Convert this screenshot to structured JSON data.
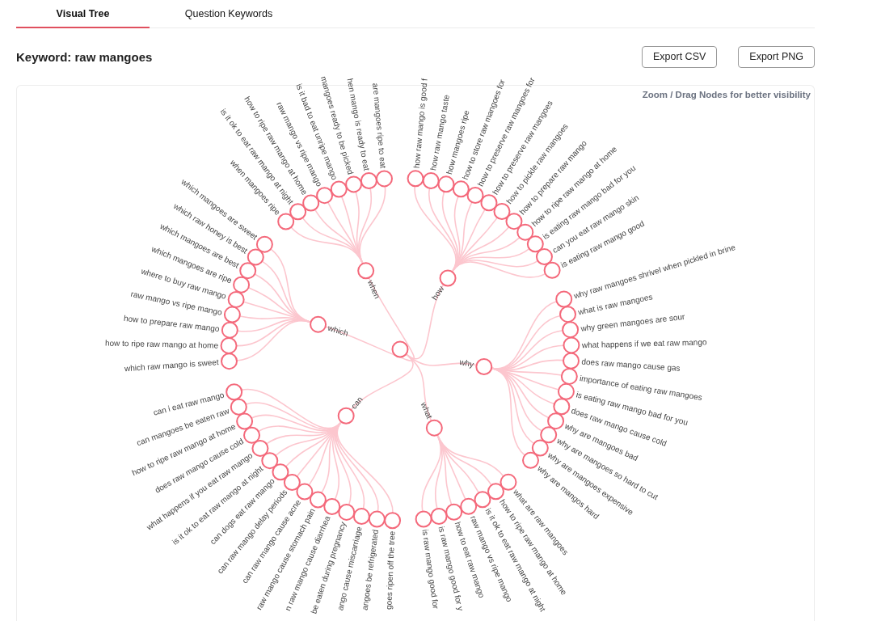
{
  "tabs": [
    {
      "label": "Visual Tree",
      "selected": true
    },
    {
      "label": "Question Keywords",
      "selected": false
    }
  ],
  "title": "Keyword: raw mangoes",
  "buttons": [
    "Export CSV",
    "Export PNG"
  ],
  "tree": {
    "hint": "Zoom / Drag Nodes for better visibility",
    "branches": [
      {
        "label": "when",
        "children": [
          {
            "label": "when mangoes ripe"
          },
          {
            "label": "is it ok to eat raw mango at night"
          },
          {
            "label": "how to ripe raw mango at home"
          },
          {
            "label": "raw mango vs ripe mango"
          },
          {
            "label": "is it bad to eat unripe mango"
          },
          {
            "label": "mangoes ready to be picked"
          },
          {
            "label": "hen mango is ready to eat"
          },
          {
            "label": "are mangoes ripe to eat"
          }
        ]
      },
      {
        "label": "how",
        "children": [
          {
            "label": "how raw mango is good f"
          },
          {
            "label": "how raw mango taste"
          },
          {
            "label": "how mangoes ripe"
          },
          {
            "label": "how to store raw mangoes for"
          },
          {
            "label": "how to preserve raw mangoes for"
          },
          {
            "label": "how to preserve raw mangoes"
          },
          {
            "label": "how to pickle raw mangoes"
          },
          {
            "label": "how to prepare raw mango"
          },
          {
            "label": "how to ripe raw mango at home"
          },
          {
            "label": "is eating raw mango bad for you"
          },
          {
            "label": "can you eat raw mango skin"
          },
          {
            "label": "is eating raw mango good"
          }
        ]
      },
      {
        "label": "why",
        "children": [
          {
            "label": "why raw mangoes shrivel when pickled in brine"
          },
          {
            "label": "what is raw mangoes"
          },
          {
            "label": "why green mangoes are sour"
          },
          {
            "label": "what happens if we eat raw mango"
          },
          {
            "label": "does raw mango cause gas"
          },
          {
            "label": "importance of eating raw mangoes"
          },
          {
            "label": "is eating raw mango bad for you"
          },
          {
            "label": "does raw mango cause cold"
          },
          {
            "label": "why are mangoes bad"
          },
          {
            "label": "why are mangoes so hard to cut"
          },
          {
            "label": "why are mangoes expensive"
          },
          {
            "label": "why are mangos hard"
          }
        ]
      },
      {
        "label": "what",
        "children": [
          {
            "label": "what are raw mangoes"
          },
          {
            "label": "how to ripe raw mango at home"
          },
          {
            "label": "is it ok to eat raw mango at night"
          },
          {
            "label": "raw mango vs ripe mango"
          },
          {
            "label": "how to eat raw mango"
          },
          {
            "label": "is raw mango good for y"
          },
          {
            "label": "is raw mango good for"
          }
        ]
      },
      {
        "label": "can",
        "children": [
          {
            "label": "goes ripen off the tree"
          },
          {
            "label": "angoes be refrigerated"
          },
          {
            "label": "ango cause miscarriage"
          },
          {
            "label": "be eaten during pregnancy"
          },
          {
            "label": "n raw mango cause diarrhea"
          },
          {
            "label": "raw mango cause stomach pain"
          },
          {
            "label": "can raw mango cause acne"
          },
          {
            "label": "can raw mango delay periods"
          },
          {
            "label": "can dogs eat raw mango"
          },
          {
            "label": "is it ok to eat raw mango at night"
          },
          {
            "label": "what happens if you eat raw mango"
          },
          {
            "label": "does raw mango cause cold"
          },
          {
            "label": "how to ripe raw mango at home"
          },
          {
            "label": "can mangoes be eaten raw"
          },
          {
            "label": "can i eat raw mango"
          }
        ]
      },
      {
        "label": "which",
        "children": [
          {
            "label": "which raw mango is sweet"
          },
          {
            "label": "how to ripe raw mango at home"
          },
          {
            "label": "how to prepare raw mango"
          },
          {
            "label": "raw mango vs ripe mango"
          },
          {
            "label": "where to buy raw mango"
          },
          {
            "label": "which mangoes are ripe"
          },
          {
            "label": "which mangoes are best"
          },
          {
            "label": "which raw honey is best"
          },
          {
            "label": "which mangoes are sweet"
          }
        ]
      }
    ]
  }
}
